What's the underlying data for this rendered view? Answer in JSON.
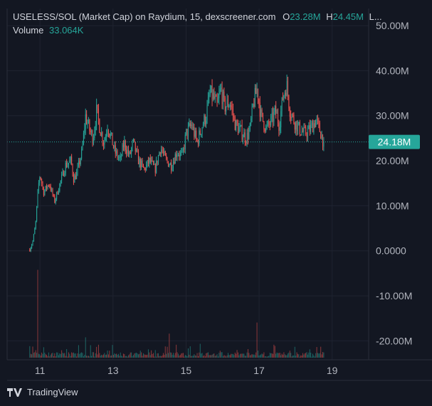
{
  "header": {
    "symbol": "USELESS/SOL (Market Cap) on Raydium, 15, dexscreener.com",
    "open_label": "O",
    "open_value": "23.28M",
    "high_label": "H",
    "high_value": "24.45M",
    "more": "L...",
    "volume_label": "Volume",
    "volume_value": "33.064K"
  },
  "price_badge": "24.18M",
  "brand": "TradingView",
  "colors": {
    "up": "#26a69a",
    "down": "#ef5350",
    "background": "#131722",
    "grid": "#1f2330",
    "text": "#b2b5be"
  },
  "chart_data": {
    "type": "candlestick",
    "title": "USELESS/SOL (Market Cap) on Raydium, 15, dexscreener.com",
    "x_tick_labels": [
      "11",
      "13",
      "15",
      "17",
      "19"
    ],
    "x_tick_values": [
      11,
      13,
      15,
      17,
      19
    ],
    "y_tick_labels": [
      "50.00M",
      "40.00M",
      "30.00M",
      "20.00M",
      "10.00M",
      "0.0000",
      "-10.00M",
      "-20.00M"
    ],
    "y_tick_values": [
      50,
      40,
      30,
      20,
      10,
      0,
      -10,
      -20
    ],
    "y_unit": "M",
    "xlim": [
      10.1,
      20.0
    ],
    "ylim": [
      -24.2,
      53.8
    ],
    "last_value": 24.18,
    "grid": true,
    "x_axis_unit": "day of month",
    "series": [
      {
        "kind": "market_cap_trend",
        "points": [
          [
            10.72,
            0.3
          ],
          [
            10.8,
            2
          ],
          [
            10.88,
            6
          ],
          [
            10.95,
            14
          ],
          [
            11.0,
            17
          ],
          [
            11.1,
            13
          ],
          [
            11.25,
            15
          ],
          [
            11.4,
            11
          ],
          [
            11.55,
            15
          ],
          [
            11.7,
            19
          ],
          [
            11.85,
            20
          ],
          [
            11.92,
            16
          ],
          [
            12.0,
            17
          ],
          [
            12.15,
            22
          ],
          [
            12.25,
            30
          ],
          [
            12.35,
            27
          ],
          [
            12.45,
            25
          ],
          [
            12.55,
            31
          ],
          [
            12.65,
            27
          ],
          [
            12.75,
            24
          ],
          [
            12.85,
            28
          ],
          [
            12.95,
            25
          ],
          [
            13.05,
            22
          ],
          [
            13.2,
            20
          ],
          [
            13.3,
            24
          ],
          [
            13.45,
            21
          ],
          [
            13.55,
            24
          ],
          [
            13.7,
            20
          ],
          [
            13.85,
            18
          ],
          [
            14.0,
            20
          ],
          [
            14.15,
            18
          ],
          [
            14.3,
            23
          ],
          [
            14.45,
            20
          ],
          [
            14.6,
            19
          ],
          [
            14.75,
            22
          ],
          [
            14.9,
            21
          ],
          [
            15.0,
            26
          ],
          [
            15.15,
            28
          ],
          [
            15.3,
            24
          ],
          [
            15.45,
            28
          ],
          [
            15.55,
            30
          ],
          [
            15.65,
            35
          ],
          [
            15.75,
            34
          ],
          [
            15.85,
            32
          ],
          [
            15.95,
            36
          ],
          [
            16.05,
            32
          ],
          [
            16.2,
            33
          ],
          [
            16.35,
            28
          ],
          [
            16.45,
            27
          ],
          [
            16.55,
            26
          ],
          [
            16.65,
            25
          ],
          [
            16.75,
            27
          ],
          [
            16.85,
            33
          ],
          [
            16.95,
            36
          ],
          [
            17.05,
            30
          ],
          [
            17.2,
            27
          ],
          [
            17.35,
            29
          ],
          [
            17.45,
            31
          ],
          [
            17.55,
            28
          ],
          [
            17.65,
            34
          ],
          [
            17.75,
            37
          ],
          [
            17.85,
            31
          ],
          [
            17.95,
            29
          ],
          [
            18.1,
            27
          ],
          [
            18.25,
            26
          ],
          [
            18.4,
            27
          ],
          [
            18.55,
            29
          ],
          [
            18.65,
            27
          ],
          [
            18.72,
            25.5
          ],
          [
            18.77,
            23.5
          ]
        ]
      },
      {
        "kind": "volume_spikes",
        "points": [
          [
            10.8,
            12
          ],
          [
            10.93,
            95
          ],
          [
            11.2,
            10
          ],
          [
            11.6,
            8
          ],
          [
            12.25,
            22
          ],
          [
            12.6,
            14
          ],
          [
            13.0,
            12
          ],
          [
            13.6,
            10
          ],
          [
            14.55,
            26
          ],
          [
            15.05,
            10
          ],
          [
            15.7,
            30
          ],
          [
            16.3,
            10
          ],
          [
            16.95,
            38
          ],
          [
            17.4,
            14
          ],
          [
            17.75,
            10
          ],
          [
            18.3,
            6
          ]
        ]
      }
    ]
  }
}
